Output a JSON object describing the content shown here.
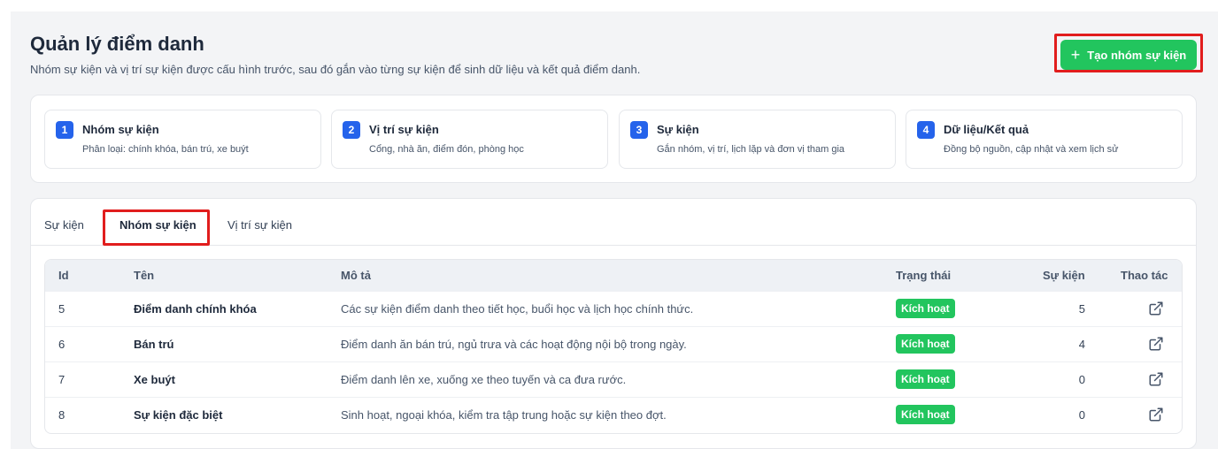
{
  "header": {
    "title": "Quản lý điểm danh",
    "subtitle": "Nhóm sự kiện và vị trí sự kiện được cấu hình trước, sau đó gắn vào từng sự kiện để sinh dữ liệu và kết quả điểm danh.",
    "create_button": {
      "icon": "plus-icon",
      "label": "Tạo nhóm sự kiện"
    }
  },
  "steps": [
    {
      "number": "1",
      "title": "Nhóm sự kiện",
      "desc": "Phân loại: chính khóa, bán trú, xe buýt"
    },
    {
      "number": "2",
      "title": "Vị trí sự kiện",
      "desc": "Cổng, nhà ăn, điểm đón, phòng học"
    },
    {
      "number": "3",
      "title": "Sự kiện",
      "desc": "Gắn nhóm, vị trí, lịch lặp và đơn vị tham gia"
    },
    {
      "number": "4",
      "title": "Dữ liệu/Kết quả",
      "desc": "Đồng bộ nguồn, cập nhật và xem lịch sử"
    }
  ],
  "tabs": [
    {
      "label": "Sự kiện",
      "active": false
    },
    {
      "label": "Nhóm sự kiện",
      "active": true
    },
    {
      "label": "Vị trí sự kiện",
      "active": false
    }
  ],
  "table": {
    "columns": [
      "Id",
      "Tên",
      "Mô tả",
      "Trạng thái",
      "Sự kiện",
      "Thao tác"
    ],
    "rows": [
      {
        "id": "5",
        "name": "Điểm danh chính khóa",
        "desc": "Các sự kiện điểm danh theo tiết học, buổi học và lịch học chính thức.",
        "status": "Kích hoạt",
        "count": "5",
        "action_icon": "external-link-icon"
      },
      {
        "id": "6",
        "name": "Bán trú",
        "desc": "Điểm danh ăn bán trú, ngủ trưa và các hoạt động nội bộ trong ngày.",
        "status": "Kích hoạt",
        "count": "4",
        "action_icon": "external-link-icon"
      },
      {
        "id": "7",
        "name": "Xe buýt",
        "desc": "Điểm danh lên xe, xuống xe theo tuyến và ca đưa rước.",
        "status": "Kích hoạt",
        "count": "0",
        "action_icon": "external-link-icon"
      },
      {
        "id": "8",
        "name": "Sự kiện đặc biệt",
        "desc": "Sinh hoạt, ngoại khóa, kiểm tra tập trung hoặc sự kiện theo đợt.",
        "status": "Kích hoạt",
        "count": "0",
        "action_icon": "external-link-icon"
      }
    ]
  },
  "colors": {
    "accent_green": "#22c55e",
    "step_blue": "#2563eb",
    "highlight_red": "#e11d1d"
  }
}
